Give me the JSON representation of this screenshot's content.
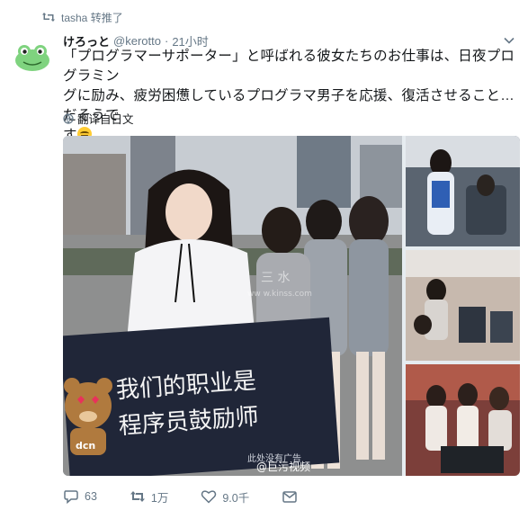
{
  "retweet": {
    "text": "tasha 转推了"
  },
  "author": {
    "display_name": "けろっと",
    "handle": "@kerotto",
    "separator": "·",
    "time": "21小时"
  },
  "tweet": {
    "line1": "「プログラマーサポーター」と呼ばれる彼女たちのお仕事は、日夜プログラミン",
    "line2": "グに励み、疲労困憊しているプログラマ男子を応援、復活させること…だそうで",
    "line3": "す"
  },
  "translate": {
    "label": "翻译自日文"
  },
  "media": {
    "sign_line1": "我们的职业是",
    "sign_line2": "程序员鼓励师",
    "sign_footer": "此处没有广告",
    "source_watermark": "@巨污视频",
    "mascot_label": "dcn",
    "site_watermark_top": "三 水",
    "site_watermark_bottom": "ww w.kinss.com"
  },
  "actions": {
    "replies": "63",
    "retweets": "1万",
    "likes": "9.0千"
  },
  "colors": {
    "text": "#14171a",
    "secondary": "#657786",
    "avatar_green": "#7fd37f"
  }
}
